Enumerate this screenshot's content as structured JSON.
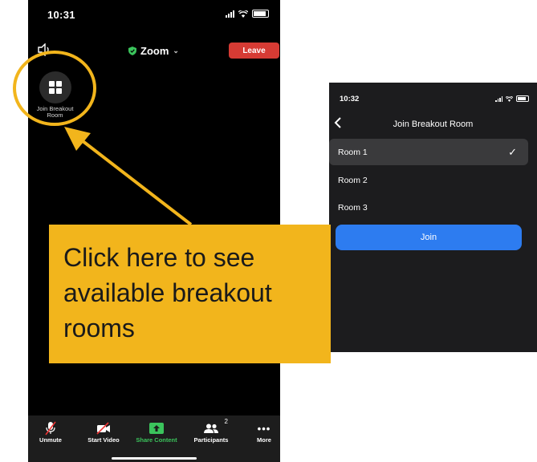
{
  "left_phone": {
    "status_time": "10:31",
    "meeting_title": "Zoom",
    "leave_label": "Leave",
    "breakout_label_line1": "Join Breakout",
    "breakout_label_line2": "Room",
    "toolbar": {
      "unmute": "Unmute",
      "start_video": "Start Video",
      "share_content": "Share Content",
      "participants": "Participants",
      "participants_count": "2",
      "more": "More"
    },
    "icons": [
      "speaker-icon",
      "shield-icon",
      "chevron-down-icon",
      "grid-icon",
      "mic-muted-icon",
      "video-off-icon",
      "share-arrow-icon",
      "participants-icon",
      "more-icon"
    ]
  },
  "right_phone": {
    "status_time": "10:32",
    "title": "Join Breakout Room",
    "rooms": [
      {
        "label": "Room 1",
        "selected": true
      },
      {
        "label": "Room 2",
        "selected": false
      },
      {
        "label": "Room 3",
        "selected": false
      }
    ],
    "check_mark": "✓",
    "join_label": "Join"
  },
  "callout": {
    "line1": "Click here to see",
    "line2": "available breakout",
    "line3": "rooms"
  },
  "colors": {
    "highlight": "#f2b51c",
    "leave": "#d63b34",
    "join": "#2d7cf0",
    "share": "#3bc45c"
  }
}
